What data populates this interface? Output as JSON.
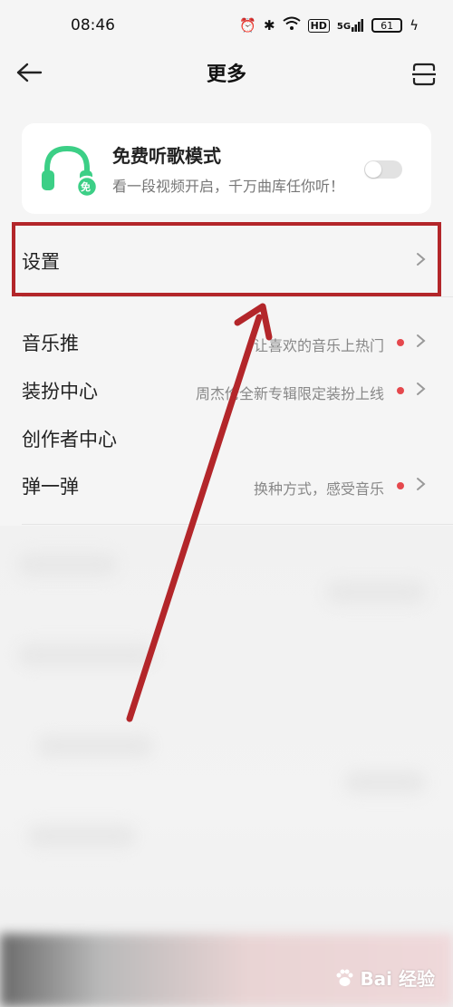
{
  "status_bar": {
    "time": "08:46",
    "network": "5G",
    "hd": "HD",
    "battery": "61"
  },
  "header": {
    "title": "更多"
  },
  "free_mode": {
    "title": "免费听歌模式",
    "description": "看一段视频开启，千万曲库任你听！",
    "badge": "免"
  },
  "menu": {
    "settings": {
      "label": "设置"
    },
    "items": [
      {
        "label": "音乐推",
        "hint": "让喜欢的音乐上热门"
      },
      {
        "label": "装扮中心",
        "hint": "周杰伦全新专辑限定装扮上线"
      },
      {
        "label": "创作者中心"
      },
      {
        "label": "弹一弹",
        "hint": "换种方式，感受音乐"
      }
    ]
  },
  "watermark": {
    "text": "Bai 经验"
  },
  "colors": {
    "accent_green": "#3ccf86",
    "annotation_red": "#b3262a",
    "dot_red": "#e5484d"
  }
}
